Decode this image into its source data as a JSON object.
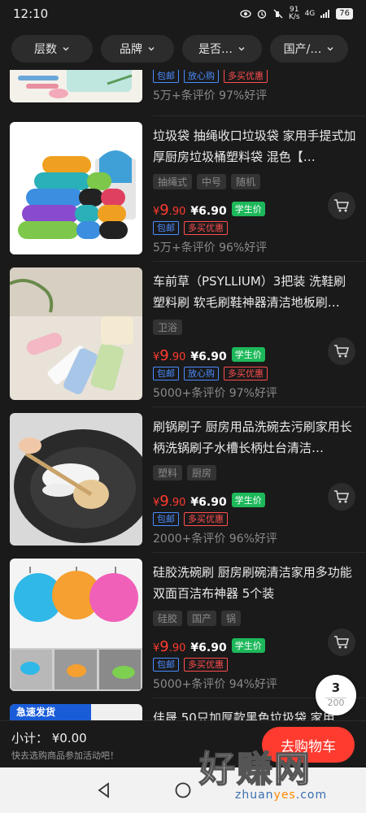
{
  "status_bar": {
    "time": "12:10",
    "net_speed": "91\nK/s",
    "net_type": "4G",
    "battery": "76"
  },
  "filters": [
    {
      "label": "层数"
    },
    {
      "label": "品牌"
    },
    {
      "label": "是否…"
    },
    {
      "label": "国产/…"
    }
  ],
  "items": [
    {
      "title": "",
      "tags": [],
      "price_red": {
        "yen": "¥",
        "int": "",
        "cents": ""
      },
      "price_white": "",
      "student": "",
      "badges": [
        {
          "text": "包邮",
          "style": "blue"
        },
        {
          "text": "放心购",
          "style": "blue"
        },
        {
          "text": "多买优惠",
          "style": "red"
        }
      ],
      "reviews": "5万+条评价  97%好评"
    },
    {
      "title": "垃圾袋 抽绳收口垃圾袋 家用手提式加厚厨房垃圾桶塑料袋 混色【…",
      "tags": [
        "抽绳式",
        "中号",
        "随机"
      ],
      "price_red": {
        "yen": "¥",
        "int": "9",
        "cents": ".90"
      },
      "price_white": "¥6.90",
      "student": "学生价",
      "badges": [
        {
          "text": "包邮",
          "style": "blue"
        },
        {
          "text": "多买优惠",
          "style": "red"
        }
      ],
      "reviews": "5万+条评价  96%好评"
    },
    {
      "title": "车前草（PSYLLIUM）3把装 洗鞋刷塑料刷 软毛刷鞋神器清洁地板刷…",
      "tags": [
        "卫浴"
      ],
      "price_red": {
        "yen": "¥",
        "int": "9",
        "cents": ".90"
      },
      "price_white": "¥6.90",
      "student": "学生价",
      "badges": [
        {
          "text": "包邮",
          "style": "blue"
        },
        {
          "text": "放心购",
          "style": "blue"
        },
        {
          "text": "多买优惠",
          "style": "red"
        }
      ],
      "reviews": "5000+条评价  97%好评"
    },
    {
      "title": "刷锅刷子 厨房用品洗碗去污刷家用长柄洗锅刷子水槽长柄灶台清洁…",
      "tags": [
        "塑料",
        "厨房"
      ],
      "price_red": {
        "yen": "¥",
        "int": "9",
        "cents": ".90"
      },
      "price_white": "¥6.90",
      "student": "学生价",
      "badges": [
        {
          "text": "包邮",
          "style": "blue"
        },
        {
          "text": "多买优惠",
          "style": "red"
        }
      ],
      "reviews": "2000+条评价  96%好评"
    },
    {
      "title": "硅胶洗碗刷 厨房刷碗清洁家用多功能双面百洁布神器 5个装",
      "tags": [
        "硅胶",
        "国产",
        "锅"
      ],
      "price_red": {
        "yen": "¥",
        "int": "9",
        "cents": ".90"
      },
      "price_white": "¥6.90",
      "student": "学生价",
      "badges": [
        {
          "text": "包邮",
          "style": "blue"
        },
        {
          "text": "多买优惠",
          "style": "red"
        }
      ],
      "reviews": "5000+条评价  94%好评"
    },
    {
      "title": "佳晟 50只加厚款黑色垃圾袋 家用",
      "thumb_label": "急速发货",
      "tags": [],
      "price_red": {
        "yen": "",
        "int": "",
        "cents": ""
      },
      "price_white": "",
      "student": "",
      "badges": [],
      "reviews": ""
    }
  ],
  "floating_counter": {
    "current": "3",
    "total": "200"
  },
  "bottom_bar": {
    "subtotal": "小计：  ¥0.00",
    "hint": "快去选购商品参加活动吧！",
    "go_cart": "去购物车"
  },
  "watermark": {
    "big": "好赚网",
    "small_a": "zhuan",
    "small_b": "yes",
    "small_c": ".com"
  },
  "colors": {
    "accent_red": "#ff3b30",
    "student_green": "#1db85a",
    "badge_blue": "#4a8cff",
    "background": "#1a1a1a"
  }
}
